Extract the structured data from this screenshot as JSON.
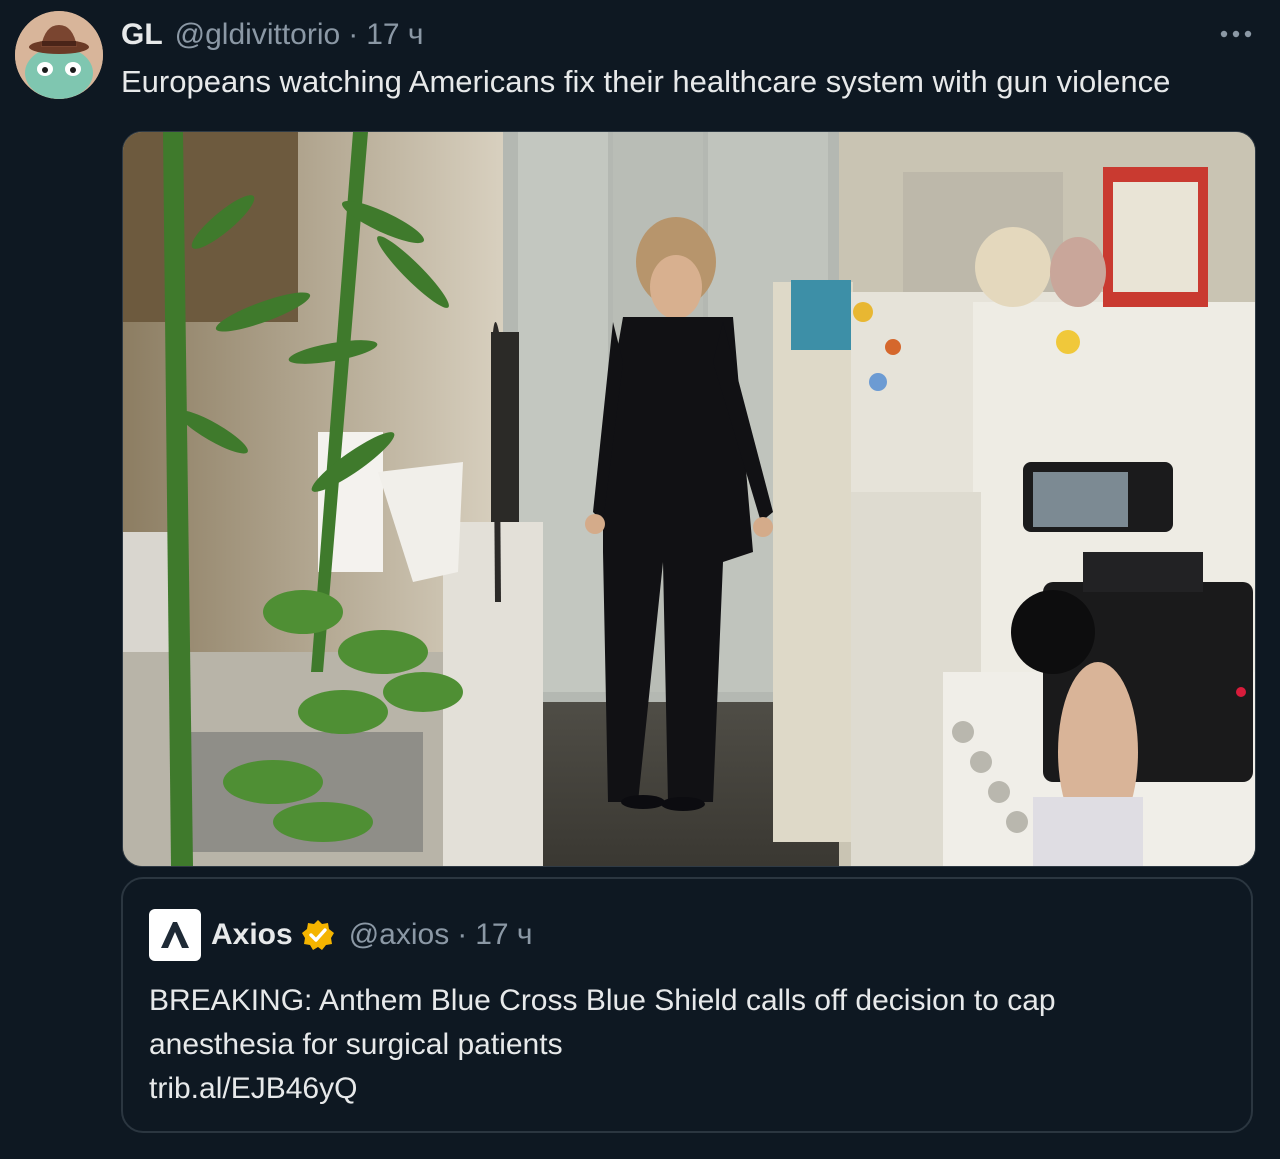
{
  "tweet": {
    "display_name": "GL",
    "handle": "@gldivittorio",
    "separator": "·",
    "timestamp": "17 ч",
    "more_icon": "ellipsis-icon",
    "text": "Europeans watching Americans fix their healthcare system with gun violence",
    "avatar_icon": "avatar-cartoon-frog-hat"
  },
  "quote": {
    "logo_icon": "axios-logo-icon",
    "display_name": "Axios",
    "verified_icon": "verified-badge-icon",
    "handle": "@axios",
    "separator": "·",
    "timestamp": "17 ч",
    "text_lines": [
      "BREAKING: Anthem Blue Cross Blue Shield calls off decision to cap",
      "anesthesia for surgical patients",
      "trib.al/EJB46yQ"
    ]
  },
  "colors": {
    "background": "#0e1822",
    "text_primary": "#e7e9ea",
    "text_secondary": "#8b98a5",
    "border": "#2b3640",
    "verified": "#f4b400"
  }
}
